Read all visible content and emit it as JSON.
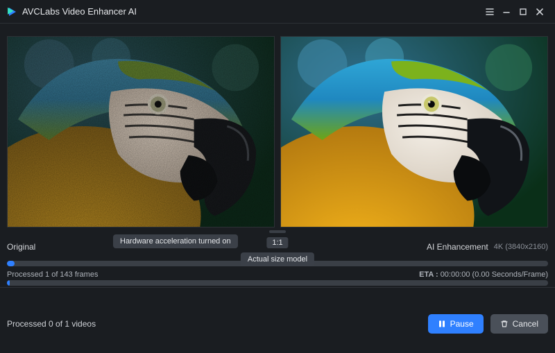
{
  "app": {
    "title": "AVCLabs Video Enhancer AI"
  },
  "preview": {
    "left_label": "Original",
    "right_label": "AI Enhancement",
    "resolution": "4K (3840x2160)",
    "ratio_pill": "1:1",
    "hw_tooltip": "Hardware acceleration turned on",
    "actual_tooltip": "Actual size model"
  },
  "progress": {
    "frames_line": "Processed 1 of 143 frames",
    "frames_fill_pct": 1.4,
    "eta_label": "ETA :",
    "eta_value": "00:00:00 (0.00 Seconds/Frame)",
    "videos_line": "Processed 0 of 1 videos",
    "videos_fill_pct": 0.5
  },
  "buttons": {
    "pause": "Pause",
    "cancel": "Cancel"
  }
}
